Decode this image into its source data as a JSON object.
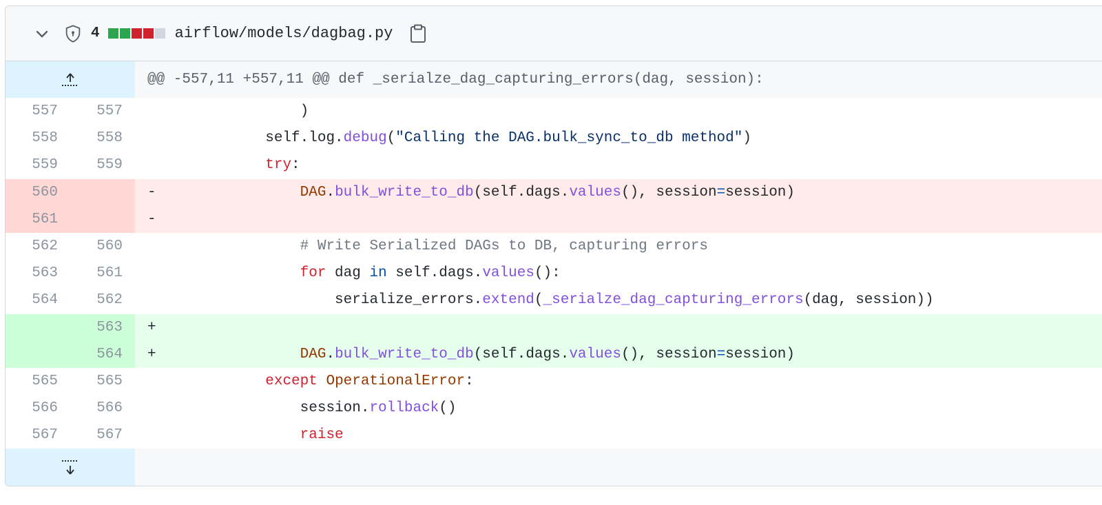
{
  "file": {
    "change_count": "4",
    "path": "airflow/models/dagbag.py",
    "diffstat_colors": [
      "#2da44e",
      "#2da44e",
      "#cf222e",
      "#cf222e",
      "#d0d7de"
    ]
  },
  "hunk": {
    "header": "@@ -557,11 +557,11 @@ def _serialze_dag_capturing_errors(dag, session):"
  },
  "lines": [
    {
      "old": "557",
      "new": "557",
      "type": "ctx",
      "marker": "",
      "tokens": [
        [
          "",
          "                )"
        ]
      ]
    },
    {
      "old": "558",
      "new": "558",
      "type": "ctx",
      "marker": "",
      "tokens": [
        [
          "",
          "            self.log."
        ],
        [
          "fn",
          "debug"
        ],
        [
          "",
          "("
        ],
        [
          "str",
          "\"Calling the DAG.bulk_sync_to_db method\""
        ],
        [
          "",
          ")"
        ]
      ]
    },
    {
      "old": "559",
      "new": "559",
      "type": "ctx",
      "marker": "",
      "tokens": [
        [
          "",
          "            "
        ],
        [
          "kw",
          "try"
        ],
        [
          "",
          ":"
        ]
      ]
    },
    {
      "old": "560",
      "new": "",
      "type": "del",
      "marker": "-",
      "tokens": [
        [
          "",
          "                "
        ],
        [
          "cls",
          "DAG"
        ],
        [
          "",
          "."
        ],
        [
          "fn",
          "bulk_write_to_db"
        ],
        [
          "",
          "(self.dags."
        ],
        [
          "fn",
          "values"
        ],
        [
          "",
          "(), session"
        ],
        [
          "op",
          "="
        ],
        [
          "",
          "session)"
        ]
      ]
    },
    {
      "old": "561",
      "new": "",
      "type": "del",
      "marker": "-",
      "tokens": [
        [
          "",
          ""
        ]
      ]
    },
    {
      "old": "562",
      "new": "560",
      "type": "ctx",
      "marker": "",
      "tokens": [
        [
          "",
          "                "
        ],
        [
          "cm",
          "# Write Serialized DAGs to DB, capturing errors"
        ]
      ]
    },
    {
      "old": "563",
      "new": "561",
      "type": "ctx",
      "marker": "",
      "tokens": [
        [
          "",
          "                "
        ],
        [
          "kw",
          "for"
        ],
        [
          "",
          " dag "
        ],
        [
          "op",
          "in"
        ],
        [
          "",
          " self.dags."
        ],
        [
          "fn",
          "values"
        ],
        [
          "",
          "():"
        ]
      ]
    },
    {
      "old": "564",
      "new": "562",
      "type": "ctx",
      "marker": "",
      "tokens": [
        [
          "",
          "                    serialize_errors."
        ],
        [
          "fn",
          "extend"
        ],
        [
          "",
          "("
        ],
        [
          "fn",
          "_serialze_dag_capturing_errors"
        ],
        [
          "",
          "(dag, session))"
        ]
      ]
    },
    {
      "old": "",
      "new": "563",
      "type": "add",
      "marker": "+",
      "tokens": [
        [
          "",
          ""
        ]
      ]
    },
    {
      "old": "",
      "new": "564",
      "type": "add",
      "marker": "+",
      "tokens": [
        [
          "",
          "                "
        ],
        [
          "cls",
          "DAG"
        ],
        [
          "",
          "."
        ],
        [
          "fn",
          "bulk_write_to_db"
        ],
        [
          "",
          "(self.dags."
        ],
        [
          "fn",
          "values"
        ],
        [
          "",
          "(), session"
        ],
        [
          "op",
          "="
        ],
        [
          "",
          "session)"
        ]
      ]
    },
    {
      "old": "565",
      "new": "565",
      "type": "ctx",
      "marker": "",
      "tokens": [
        [
          "",
          "            "
        ],
        [
          "kw",
          "except"
        ],
        [
          "",
          " "
        ],
        [
          "cls",
          "OperationalError"
        ],
        [
          "",
          ":"
        ]
      ]
    },
    {
      "old": "566",
      "new": "566",
      "type": "ctx",
      "marker": "",
      "tokens": [
        [
          "",
          "                session."
        ],
        [
          "fn",
          "rollback"
        ],
        [
          "",
          "()"
        ]
      ]
    },
    {
      "old": "567",
      "new": "567",
      "type": "ctx",
      "marker": "",
      "tokens": [
        [
          "",
          "                "
        ],
        [
          "kw",
          "raise"
        ]
      ]
    }
  ]
}
